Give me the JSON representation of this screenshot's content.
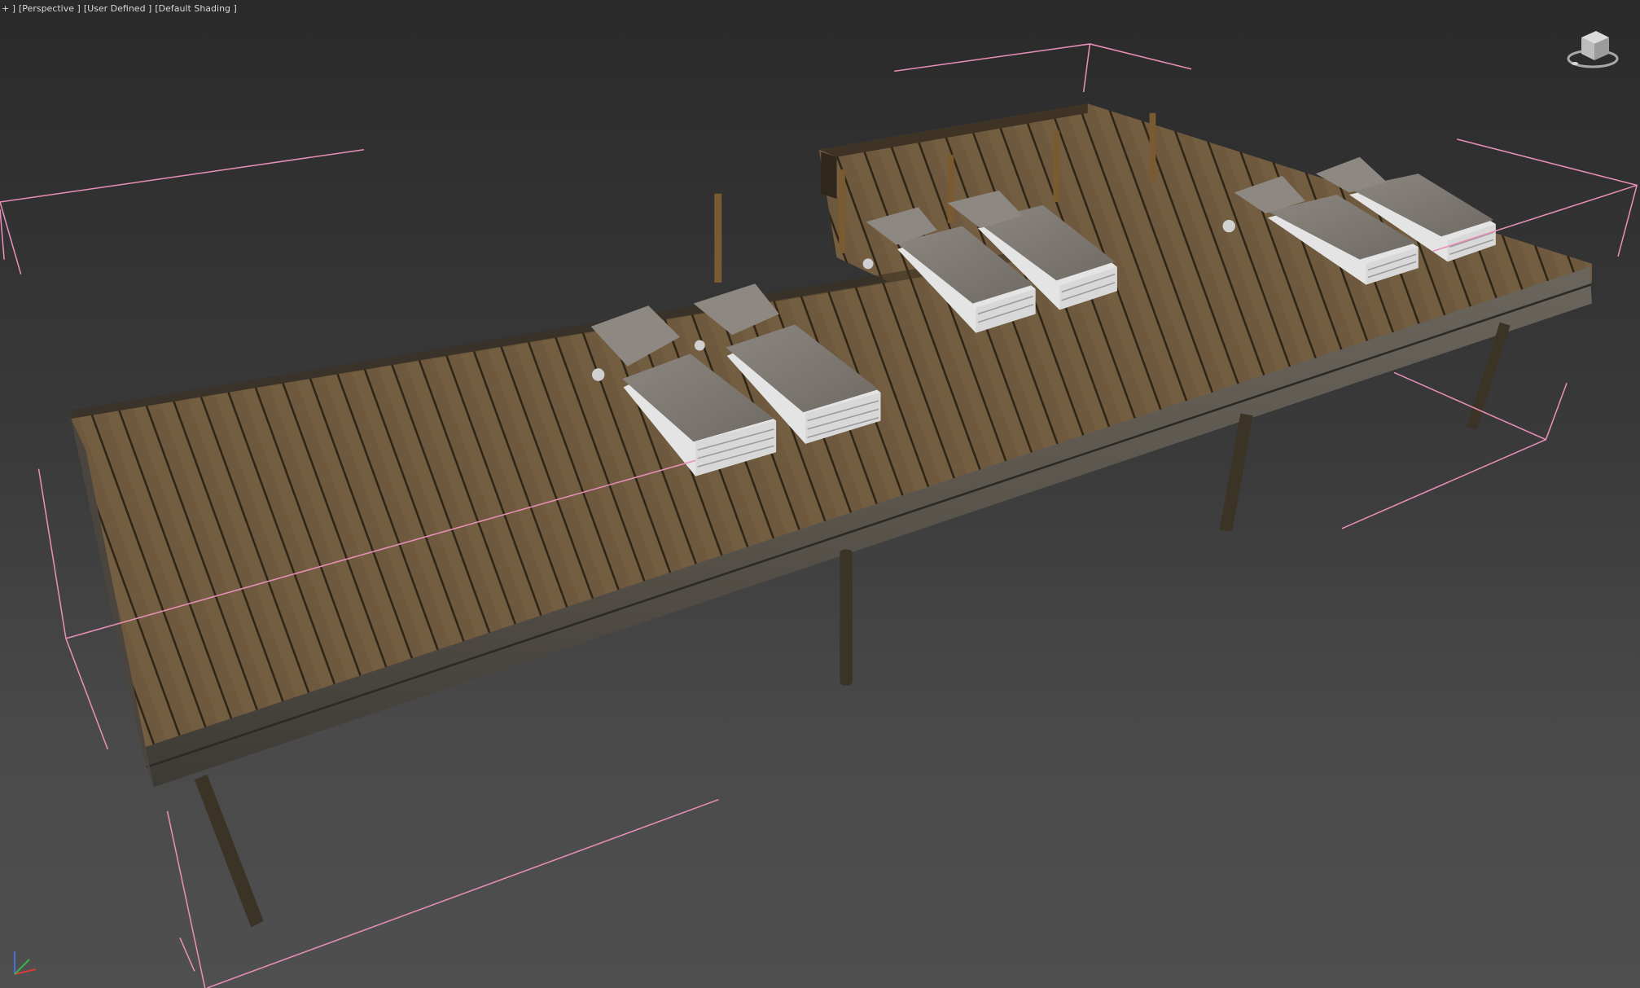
{
  "viewport": {
    "labels": {
      "plus": "+ ]",
      "view": "[Perspective ]",
      "display": "[User Defined ]",
      "shading": "[Default Shading ]"
    }
  },
  "scene": {
    "objects": {
      "deck": "wooden-deck",
      "loungers": 6,
      "posts": 5,
      "support_legs": 4
    },
    "selection_bracket_color": "#e88fb8"
  },
  "colors": {
    "background_top": "#2a2a2a",
    "background_bottom": "#4f4f4f",
    "deck_wood": "#6e5a3f",
    "cushion": "#807a74",
    "frame": "#e4e4e4"
  },
  "icons": [
    "viewcube-icon",
    "axis-tripod-icon"
  ]
}
